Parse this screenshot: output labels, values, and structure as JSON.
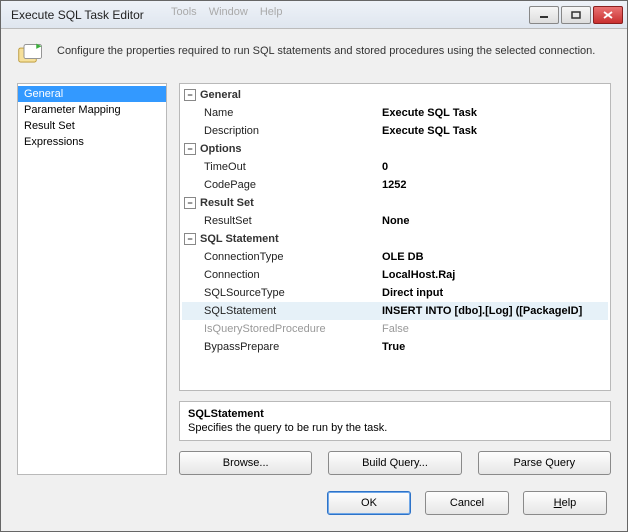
{
  "window": {
    "title": "Execute SQL Task Editor"
  },
  "menu_hint": [
    "Tools",
    "Window",
    "Help"
  ],
  "header": {
    "description": "Configure the properties required to run SQL statements and stored procedures using the selected connection."
  },
  "nav": {
    "items": [
      {
        "label": "General",
        "selected": true
      },
      {
        "label": "Parameter Mapping",
        "selected": false
      },
      {
        "label": "Result Set",
        "selected": false
      },
      {
        "label": "Expressions",
        "selected": false
      }
    ]
  },
  "groups": [
    {
      "name": "General",
      "rows": [
        {
          "key": "Name",
          "value": "Execute SQL Task"
        },
        {
          "key": "Description",
          "value": "Execute SQL Task"
        }
      ]
    },
    {
      "name": "Options",
      "rows": [
        {
          "key": "TimeOut",
          "value": "0"
        },
        {
          "key": "CodePage",
          "value": "1252"
        }
      ]
    },
    {
      "name": "Result Set",
      "rows": [
        {
          "key": "ResultSet",
          "value": "None"
        }
      ]
    },
    {
      "name": "SQL Statement",
      "rows": [
        {
          "key": "ConnectionType",
          "value": "OLE DB"
        },
        {
          "key": "Connection",
          "value": "LocalHost.Raj"
        },
        {
          "key": "SQLSourceType",
          "value": "Direct input"
        },
        {
          "key": "SQLStatement",
          "value": "INSERT INTO [dbo].[Log]          ([PackageID]",
          "selected": true
        },
        {
          "key": "IsQueryStoredProcedure",
          "value": "False",
          "disabled": true
        },
        {
          "key": "BypassPrepare",
          "value": "True"
        }
      ]
    }
  ],
  "help": {
    "title": "SQLStatement",
    "text": "Specifies the query to be run by the task."
  },
  "actions": {
    "browse": "Browse...",
    "build_query": "Build Query...",
    "parse_query": "Parse Query"
  },
  "footer": {
    "ok": "OK",
    "cancel": "Cancel",
    "help": "Help"
  }
}
